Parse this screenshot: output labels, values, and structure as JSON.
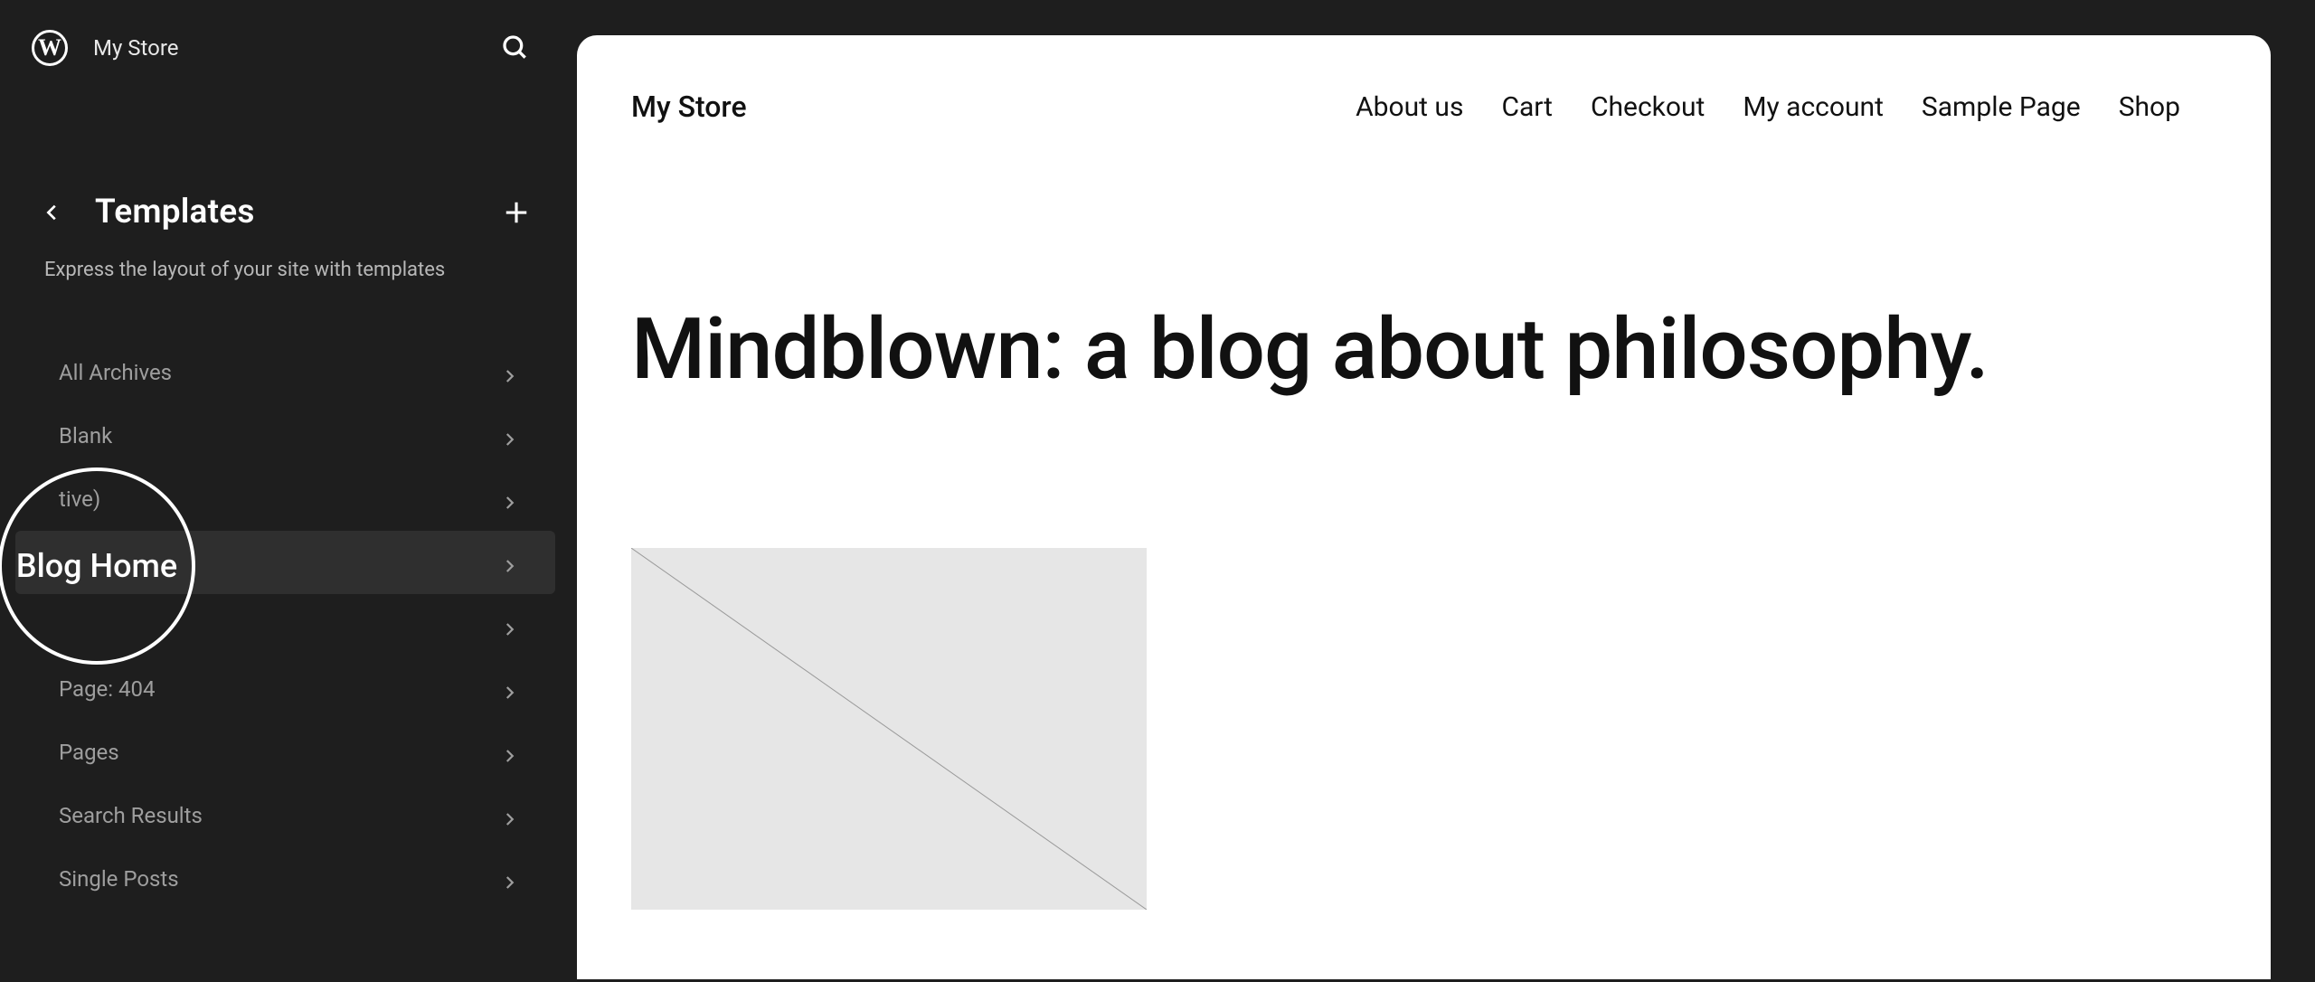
{
  "sidebar": {
    "site_name": "My Store",
    "section_title": "Templates",
    "section_desc": "Express the layout of your site with templates",
    "highlight_label": "Blog Home",
    "templates": [
      {
        "label": "All Archives",
        "active": false
      },
      {
        "label": "Blank",
        "active": false
      },
      {
        "label": "tive)",
        "active": false
      },
      {
        "label": "",
        "active": true
      },
      {
        "label": "",
        "active": false
      },
      {
        "label": "Page: 404",
        "active": false
      },
      {
        "label": "Pages",
        "active": false
      },
      {
        "label": "Search Results",
        "active": false
      },
      {
        "label": "Single Posts",
        "active": false
      }
    ]
  },
  "preview": {
    "site_title": "My Store",
    "nav": [
      "About us",
      "Cart",
      "Checkout",
      "My account",
      "Sample Page",
      "Shop"
    ],
    "hero_title": "Mindblown: a blog about philosophy."
  },
  "colors": {
    "sidebar_bg": "#1e1e1e",
    "canvas_bg": "#ffffff",
    "text_muted": "#9e9e9e",
    "placeholder": "#e6e6e6"
  }
}
